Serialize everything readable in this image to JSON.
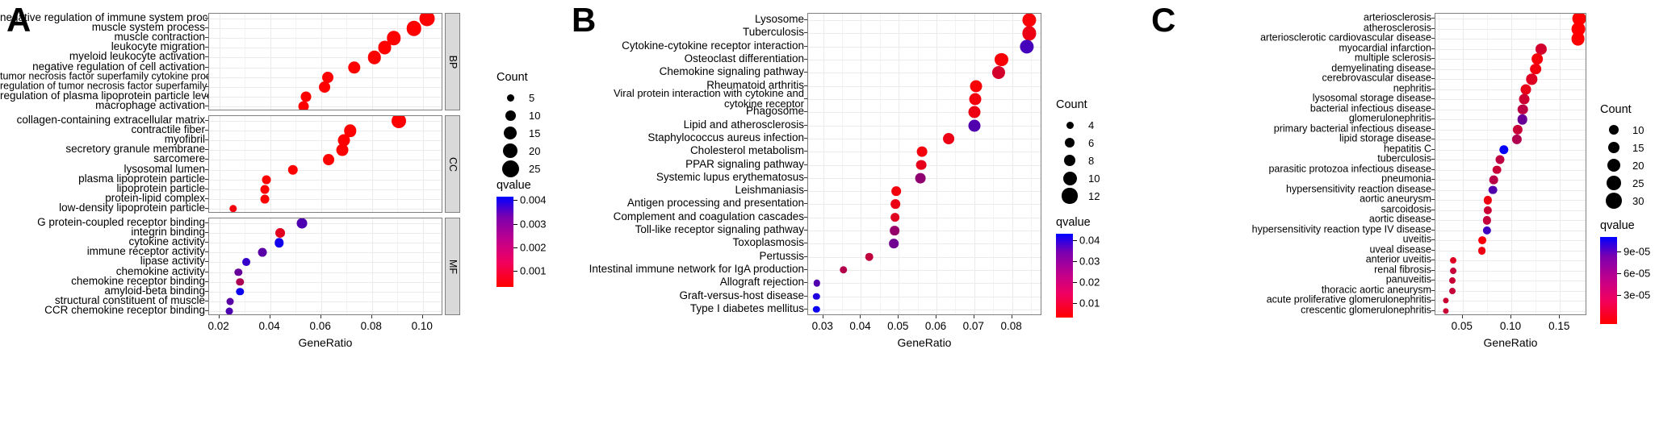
{
  "figure": {
    "panels": [
      {
        "letter": "A",
        "axis_label": "GeneRatio",
        "xticks": [
          "0.02",
          "0.04",
          "0.06",
          "0.08",
          "0.10"
        ],
        "xtick_values": [
          0.02,
          0.04,
          0.06,
          0.08,
          0.1
        ],
        "count_legend_title": "Count",
        "count_legend": [
          "5",
          "10",
          "15",
          "20",
          "25"
        ],
        "qvalue_legend_title": "qvalue",
        "qvalue_legend": [
          "0.004",
          "0.003",
          "0.002",
          "0.001"
        ],
        "strips": [
          "BP",
          "CC",
          "MF"
        ]
      },
      {
        "letter": "B",
        "axis_label": "GeneRatio",
        "xticks": [
          "0.03",
          "0.04",
          "0.05",
          "0.06",
          "0.07",
          "0.08"
        ],
        "xtick_values": [
          0.03,
          0.04,
          0.05,
          0.06,
          0.07,
          0.08
        ],
        "count_legend_title": "Count",
        "count_legend": [
          "4",
          "6",
          "8",
          "10",
          "12"
        ],
        "qvalue_legend_title": "qvalue",
        "qvalue_legend": [
          "0.04",
          "0.03",
          "0.02",
          "0.01"
        ]
      },
      {
        "letter": "C",
        "axis_label": "GeneRatio",
        "xticks": [
          "0.05",
          "0.10",
          "0.15"
        ],
        "xtick_values": [
          0.05,
          0.1,
          0.15
        ],
        "count_legend_title": "Count",
        "count_legend": [
          "10",
          "15",
          "20",
          "25",
          "30"
        ],
        "qvalue_legend_title": "qvalue",
        "qvalue_legend": [
          "9e-05",
          "6e-05",
          "3e-05"
        ]
      }
    ]
  },
  "chart_data": [
    {
      "type": "scatter",
      "title": "A",
      "xlabel": "GeneRatio",
      "ylabel": "",
      "xlim": [
        0.016,
        0.108
      ],
      "size_legend": {
        "name": "Count",
        "values": [
          5,
          10,
          15,
          20,
          25
        ]
      },
      "color_legend": {
        "name": "qvalue",
        "values": [
          0.004,
          0.003,
          0.002,
          0.001
        ],
        "low_color": "#ff0000",
        "high_color": "#0000ff"
      },
      "facets": [
        {
          "strip": "BP",
          "points": [
            {
              "term": "negative regulation of immune system process",
              "GeneRatio": 0.1015,
              "Count": 26,
              "qvalue": 0.0002
            },
            {
              "term": "muscle system process",
              "GeneRatio": 0.0965,
              "Count": 25,
              "qvalue": 0.0002
            },
            {
              "term": "muscle contraction",
              "GeneRatio": 0.0885,
              "Count": 23,
              "qvalue": 0.0002
            },
            {
              "term": "leukocyte migration",
              "GeneRatio": 0.085,
              "Count": 22,
              "qvalue": 0.0002
            },
            {
              "term": "myeloid leukocyte activation",
              "GeneRatio": 0.081,
              "Count": 21,
              "qvalue": 0.0002
            },
            {
              "term": "negative regulation of cell activation",
              "GeneRatio": 0.073,
              "Count": 19,
              "qvalue": 0.0002
            },
            {
              "term": "tumor necrosis factor superfamily cytokine production",
              "GeneRatio": 0.0625,
              "Count": 16,
              "qvalue": 0.0002
            },
            {
              "term": "regulation of tumor necrosis factor superfamily cytokine production",
              "GeneRatio": 0.0615,
              "Count": 16,
              "qvalue": 0.0002
            },
            {
              "term": "regulation of plasma lipoprotein particle levels",
              "GeneRatio": 0.054,
              "Count": 14,
              "qvalue": 0.0002
            },
            {
              "term": "macrophage activation",
              "GeneRatio": 0.053,
              "Count": 14,
              "qvalue": 0.0002
            }
          ]
        },
        {
          "strip": "CC",
          "points": [
            {
              "term": "collagen-containing extracellular matrix",
              "GeneRatio": 0.0905,
              "Count": 24,
              "qvalue": 0.0002
            },
            {
              "term": "contractile fiber",
              "GeneRatio": 0.0715,
              "Count": 19,
              "qvalue": 0.0002
            },
            {
              "term": "myofibril",
              "GeneRatio": 0.069,
              "Count": 18,
              "qvalue": 0.0002
            },
            {
              "term": "secretory granule membrane",
              "GeneRatio": 0.0685,
              "Count": 18,
              "qvalue": 0.0002
            },
            {
              "term": "sarcomere",
              "GeneRatio": 0.063,
              "Count": 16,
              "qvalue": 0.0002
            },
            {
              "term": "lysosomal lumen",
              "GeneRatio": 0.049,
              "Count": 13,
              "qvalue": 0.0002
            },
            {
              "term": "plasma lipoprotein particle",
              "GeneRatio": 0.0385,
              "Count": 10,
              "qvalue": 0.0002
            },
            {
              "term": "lipoprotein particle",
              "GeneRatio": 0.038,
              "Count": 10,
              "qvalue": 0.0002
            },
            {
              "term": "protein-lipid complex",
              "GeneRatio": 0.038,
              "Count": 10,
              "qvalue": 0.0002
            },
            {
              "term": "low-density lipoprotein particle",
              "GeneRatio": 0.0255,
              "Count": 7,
              "qvalue": 0.0004
            }
          ]
        },
        {
          "strip": "MF",
          "points": [
            {
              "term": "G protein-coupled receptor binding",
              "GeneRatio": 0.0525,
              "Count": 14,
              "qvalue": 0.0032
            },
            {
              "term": "integrin binding",
              "GeneRatio": 0.044,
              "Count": 12,
              "qvalue": 0.0007
            },
            {
              "term": "cytokine activity",
              "GeneRatio": 0.0435,
              "Count": 11,
              "qvalue": 0.0042
            },
            {
              "term": "immune receptor activity",
              "GeneRatio": 0.037,
              "Count": 10,
              "qvalue": 0.003
            },
            {
              "term": "lipase activity",
              "GeneRatio": 0.0305,
              "Count": 8,
              "qvalue": 0.0036
            },
            {
              "term": "chemokine activity",
              "GeneRatio": 0.0275,
              "Count": 7,
              "qvalue": 0.0028
            },
            {
              "term": "chemokine receptor binding",
              "GeneRatio": 0.0282,
              "Count": 7,
              "qvalue": 0.0016
            },
            {
              "term": "amyloid-beta binding",
              "GeneRatio": 0.0282,
              "Count": 7,
              "qvalue": 0.0043
            },
            {
              "term": "structural constituent of muscle",
              "GeneRatio": 0.0242,
              "Count": 6,
              "qvalue": 0.003
            },
            {
              "term": "CCR chemokine receptor binding",
              "GeneRatio": 0.024,
              "Count": 6,
              "qvalue": 0.0032
            }
          ]
        }
      ]
    },
    {
      "type": "scatter",
      "title": "B",
      "xlabel": "GeneRatio",
      "ylabel": "",
      "xlim": [
        0.026,
        0.088
      ],
      "size_legend": {
        "name": "Count",
        "values": [
          4,
          6,
          8,
          10,
          12
        ]
      },
      "color_legend": {
        "name": "qvalue",
        "values": [
          0.04,
          0.03,
          0.02,
          0.01
        ],
        "low_color": "#ff0000",
        "high_color": "#0000ff"
      },
      "points": [
        {
          "term": "Lysosome",
          "GeneRatio": 0.0845,
          "Count": 12,
          "qvalue": 0.002
        },
        {
          "term": "Tuberculosis",
          "GeneRatio": 0.0845,
          "Count": 12,
          "qvalue": 0.004
        },
        {
          "term": "Cytokine-cytokine receptor interaction",
          "GeneRatio": 0.084,
          "Count": 12,
          "qvalue": 0.031
        },
        {
          "term": "Osteoclast differentiation",
          "GeneRatio": 0.0772,
          "Count": 11,
          "qvalue": 0.002
        },
        {
          "term": "Chemokine signaling pathway",
          "GeneRatio": 0.0765,
          "Count": 11,
          "qvalue": 0.008
        },
        {
          "term": "Rheumatoid arthritis",
          "GeneRatio": 0.0705,
          "Count": 10,
          "qvalue": 0.002
        },
        {
          "term": "Viral protein interaction with cytokine and cytokine receptor",
          "GeneRatio": 0.0702,
          "Count": 10,
          "qvalue": 0.003
        },
        {
          "term": "Phagosome",
          "GeneRatio": 0.07,
          "Count": 10,
          "qvalue": 0.004
        },
        {
          "term": "Lipid and atherosclerosis",
          "GeneRatio": 0.07,
          "Count": 10,
          "qvalue": 0.029
        },
        {
          "term": "Staphylococcus aureus infection",
          "GeneRatio": 0.0632,
          "Count": 9,
          "qvalue": 0.004
        },
        {
          "term": "Cholesterol metabolism",
          "GeneRatio": 0.0562,
          "Count": 8,
          "qvalue": 0.003
        },
        {
          "term": "PPAR signaling pathway",
          "GeneRatio": 0.056,
          "Count": 8,
          "qvalue": 0.005
        },
        {
          "term": "Systemic lupus erythematosus",
          "GeneRatio": 0.0558,
          "Count": 8,
          "qvalue": 0.019
        },
        {
          "term": "Leishmaniasis",
          "GeneRatio": 0.0493,
          "Count": 7,
          "qvalue": 0.003
        },
        {
          "term": "Antigen processing and presentation",
          "GeneRatio": 0.0491,
          "Count": 7,
          "qvalue": 0.004
        },
        {
          "term": "Complement and coagulation cascades",
          "GeneRatio": 0.049,
          "Count": 7,
          "qvalue": 0.006
        },
        {
          "term": "Toll-like receptor signaling pathway",
          "GeneRatio": 0.0489,
          "Count": 7,
          "qvalue": 0.018
        },
        {
          "term": "Toxoplasmosis",
          "GeneRatio": 0.0487,
          "Count": 7,
          "qvalue": 0.024
        },
        {
          "term": "Pertussis",
          "GeneRatio": 0.0422,
          "Count": 6,
          "qvalue": 0.011
        },
        {
          "term": "Intestinal immune network for IgA production",
          "GeneRatio": 0.0353,
          "Count": 5,
          "qvalue": 0.013
        },
        {
          "term": "Allograft rejection",
          "GeneRatio": 0.0283,
          "Count": 4,
          "qvalue": 0.029
        },
        {
          "term": "Graft-versus-host disease",
          "GeneRatio": 0.0282,
          "Count": 4,
          "qvalue": 0.037
        },
        {
          "term": "Type I diabetes mellitus",
          "GeneRatio": 0.0282,
          "Count": 4,
          "qvalue": 0.04
        }
      ]
    },
    {
      "type": "scatter",
      "title": "C",
      "xlabel": "GeneRatio",
      "ylabel": "",
      "xlim": [
        0.022,
        0.178
      ],
      "size_legend": {
        "name": "Count",
        "values": [
          10,
          15,
          20,
          25,
          30
        ]
      },
      "color_legend": {
        "name": "qvalue",
        "values": [
          9e-05,
          6e-05,
          3e-05
        ],
        "low_color": "#ff0000",
        "high_color": "#0000ff"
      },
      "points": [
        {
          "term": "arteriosclerosis",
          "GeneRatio": 0.17,
          "Count": 31,
          "qvalue": 5e-06
        },
        {
          "term": "atherosclerosis",
          "GeneRatio": 0.169,
          "Count": 31,
          "qvalue": 5e-06
        },
        {
          "term": "arteriosclerotic cardiovascular disease",
          "GeneRatio": 0.1685,
          "Count": 31,
          "qvalue": 5e-06
        },
        {
          "term": "myocardial infarction",
          "GeneRatio": 0.131,
          "Count": 24,
          "qvalue": 2.2e-05
        },
        {
          "term": "multiple sclerosis",
          "GeneRatio": 0.1265,
          "Count": 23,
          "qvalue": 8e-06
        },
        {
          "term": "demyelinating disease",
          "GeneRatio": 0.125,
          "Count": 23,
          "qvalue": 1e-05
        },
        {
          "term": "cerebrovascular disease",
          "GeneRatio": 0.121,
          "Count": 22,
          "qvalue": 1.8e-05
        },
        {
          "term": "nephritis",
          "GeneRatio": 0.1152,
          "Count": 21,
          "qvalue": 1.4e-05
        },
        {
          "term": "lysosomal storage disease",
          "GeneRatio": 0.113,
          "Count": 21,
          "qvalue": 2.4e-05
        },
        {
          "term": "bacterial infectious disease",
          "GeneRatio": 0.112,
          "Count": 20,
          "qvalue": 3.1e-05
        },
        {
          "term": "glomerulonephritis",
          "GeneRatio": 0.1115,
          "Count": 20,
          "qvalue": 6.2e-05
        },
        {
          "term": "primary bacterial infectious disease",
          "GeneRatio": 0.1065,
          "Count": 19,
          "qvalue": 2.6e-05
        },
        {
          "term": "lipid storage disease",
          "GeneRatio": 0.106,
          "Count": 19,
          "qvalue": 3.5e-05
        },
        {
          "term": "hepatitis C",
          "GeneRatio": 0.0925,
          "Count": 17,
          "qvalue": 0.0001
        },
        {
          "term": "tuberculosis",
          "GeneRatio": 0.0885,
          "Count": 16,
          "qvalue": 3e-05
        },
        {
          "term": "parasitic protozoa infectious disease",
          "GeneRatio": 0.085,
          "Count": 15,
          "qvalue": 2.6e-05
        },
        {
          "term": "pneumonia",
          "GeneRatio": 0.0818,
          "Count": 15,
          "qvalue": 3.2e-05
        },
        {
          "term": "hypersensitivity reaction disease",
          "GeneRatio": 0.0808,
          "Count": 15,
          "qvalue": 7.1e-05
        },
        {
          "term": "aortic aneurysm",
          "GeneRatio": 0.076,
          "Count": 14,
          "qvalue": 1.2e-05
        },
        {
          "term": "sarcoidosis",
          "GeneRatio": 0.0757,
          "Count": 14,
          "qvalue": 2.5e-05
        },
        {
          "term": "aortic disease",
          "GeneRatio": 0.0753,
          "Count": 14,
          "qvalue": 2.8e-05
        },
        {
          "term": "hypersensitivity reaction type IV disease",
          "GeneRatio": 0.075,
          "Count": 14,
          "qvalue": 7.8e-05
        },
        {
          "term": "uveitis",
          "GeneRatio": 0.07,
          "Count": 13,
          "qvalue": 8e-06
        },
        {
          "term": "uveal disease",
          "GeneRatio": 0.0698,
          "Count": 13,
          "qvalue": 1.2e-05
        },
        {
          "term": "anterior uveitis",
          "GeneRatio": 0.0405,
          "Count": 8,
          "qvalue": 1.8e-05
        },
        {
          "term": "renal fibrosis",
          "GeneRatio": 0.04,
          "Count": 8,
          "qvalue": 2.6e-05
        },
        {
          "term": "panuveitis",
          "GeneRatio": 0.0398,
          "Count": 8,
          "qvalue": 2.6e-05
        },
        {
          "term": "thoracic aortic aneurysm",
          "GeneRatio": 0.0396,
          "Count": 8,
          "qvalue": 2.7e-05
        },
        {
          "term": "acute proliferative glomerulonephritis",
          "GeneRatio": 0.033,
          "Count": 6,
          "qvalue": 2.5e-05
        },
        {
          "term": "crescentic glomerulonephritis",
          "GeneRatio": 0.0328,
          "Count": 6,
          "qvalue": 2.5e-05
        }
      ]
    }
  ]
}
